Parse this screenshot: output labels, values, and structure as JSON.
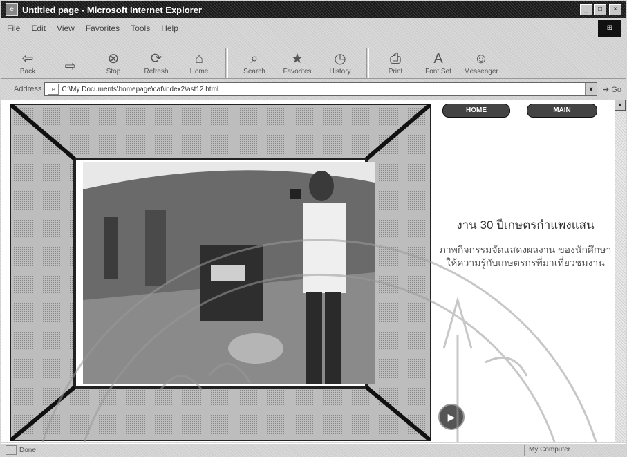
{
  "window": {
    "title": "Untitled page - Microsoft Internet Explorer",
    "buttons": [
      "_",
      "□",
      "×"
    ]
  },
  "menu": [
    "File",
    "Edit",
    "View",
    "Favorites",
    "Tools",
    "Help"
  ],
  "toolbar": [
    {
      "label": "Back",
      "icon": "back-arrow-icon",
      "glyph": "⇦"
    },
    {
      "label": "",
      "icon": "forward-arrow-icon",
      "glyph": "⇨"
    },
    {
      "label": "Stop",
      "icon": "stop-icon",
      "glyph": "⊗"
    },
    {
      "label": "Refresh",
      "icon": "refresh-icon",
      "glyph": "⟳"
    },
    {
      "label": "Home",
      "icon": "home-icon",
      "glyph": "⌂"
    },
    {
      "label": "Search",
      "icon": "search-icon",
      "glyph": "⌕"
    },
    {
      "label": "Favorites",
      "icon": "favorites-icon",
      "glyph": "★"
    },
    {
      "label": "History",
      "icon": "history-icon",
      "glyph": "◷"
    },
    {
      "label": "Print",
      "icon": "print-icon",
      "glyph": "⎙"
    },
    {
      "label": "Font Set",
      "icon": "font-icon",
      "glyph": "A"
    },
    {
      "label": "Messenger",
      "icon": "messenger-icon",
      "glyph": "☺"
    }
  ],
  "address": {
    "label": "Address",
    "url": "C:\\My Documents\\homepage\\cat\\index2\\ast12.html",
    "go": "Go"
  },
  "page": {
    "nav_home": "HOME",
    "nav_main": "MAIN",
    "heading": "งาน 30 ปีเกษตรกำแพงแสน",
    "description": "ภาพกิจกรรมจัดแสดงผลงาน ของนักศึกษา ให้ความรู้กับเกษตรกรที่มาเที่ยวชมงาน"
  },
  "status": {
    "text": "Done",
    "zone": "My Computer"
  },
  "colors": {
    "titlebar": "#2c2c2c",
    "chrome": "#d8d8d8",
    "content_bg": "#ffffff"
  }
}
